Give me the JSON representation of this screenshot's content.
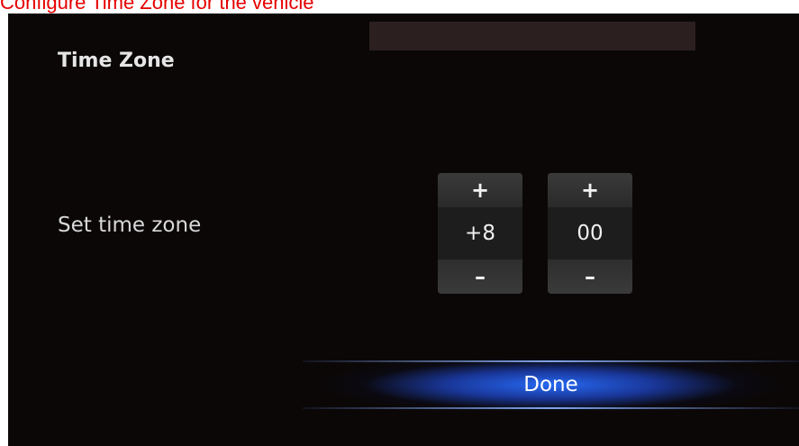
{
  "caption": "Configure Time Zone for the vehicle",
  "header": {
    "title": "Time Zone"
  },
  "time_zone_setting": {
    "label": "Set time zone",
    "hours": {
      "increment_label": "+",
      "value": "+8",
      "decrement_label": "–"
    },
    "minutes": {
      "increment_label": "+",
      "value": "00",
      "decrement_label": "–"
    }
  },
  "footer": {
    "done_label": "Done"
  },
  "colors": {
    "background": "#0b0707",
    "caption": "#e60000",
    "accent_blue": "#2a6cff"
  }
}
